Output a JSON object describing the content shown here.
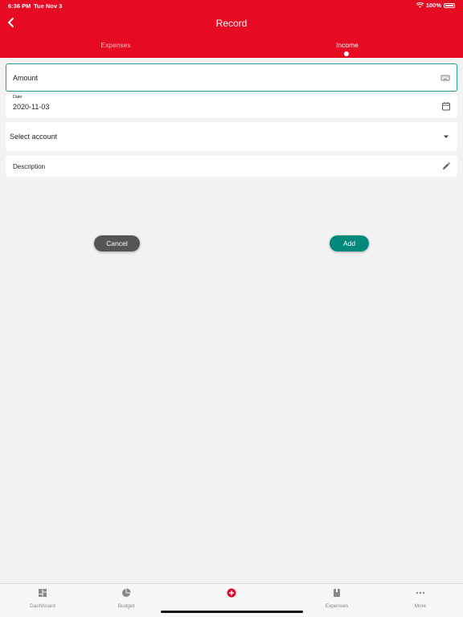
{
  "status_bar": {
    "time": "6:36 PM",
    "date": "Tue Nov 3",
    "battery": "100%"
  },
  "header": {
    "title": "Record",
    "tabs": [
      {
        "label": "Expenses"
      },
      {
        "label": "Income",
        "active": true
      }
    ]
  },
  "form": {
    "amount": {
      "placeholder": "Amount"
    },
    "date": {
      "label": "Date",
      "value": "2020-11-03"
    },
    "account": {
      "placeholder": "Select account"
    },
    "description": {
      "placeholder": "Description"
    }
  },
  "actions": {
    "cancel_label": "Cancel",
    "add_label": "Add"
  },
  "tabbar": {
    "items": [
      {
        "label": "Dashboard",
        "icon": "dashboard-icon"
      },
      {
        "label": "Budget",
        "icon": "pie-chart-icon"
      },
      {
        "label": "",
        "icon": "add-circle-icon"
      },
      {
        "label": "Expenses",
        "icon": "book-icon"
      },
      {
        "label": "More",
        "icon": "more-icon"
      }
    ]
  },
  "colors": {
    "brand": "#e60a23",
    "accent": "#00897b",
    "cancel": "#555555",
    "add_icon": "#e60a23"
  }
}
